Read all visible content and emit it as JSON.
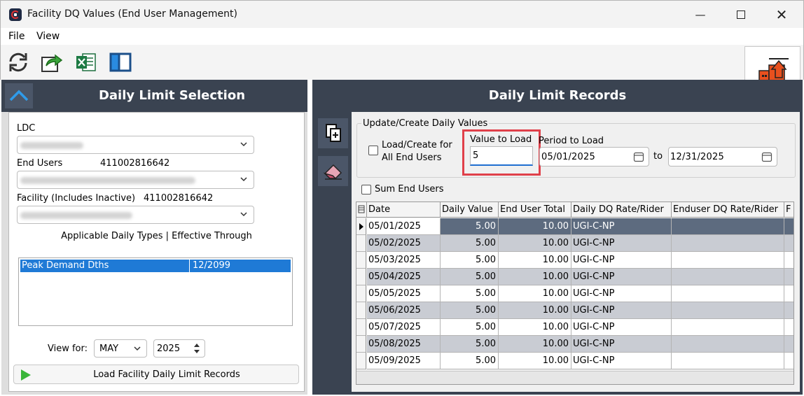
{
  "window": {
    "title": "Facility DQ Values (End User Management)",
    "minimize": "—",
    "close": "✕"
  },
  "menu": {
    "file": "File",
    "view": "View"
  },
  "toolbar": {
    "icons": [
      "refresh-icon",
      "export-icon",
      "excel-icon",
      "layout-icon"
    ]
  },
  "left": {
    "title": "Daily Limit Selection",
    "ldc_label": "LDC",
    "end_users_label": "End Users",
    "end_users_id": "411002816642",
    "facility_label": "Facility (Includes Inactive)",
    "facility_id": "411002816642",
    "types_header": "Applicable Daily Types | Effective Through",
    "types": [
      {
        "type": "Peak Demand Dths",
        "through": "12/2099"
      }
    ],
    "view_for_label": "View for:",
    "month": "MAY",
    "year": "2025",
    "load_button": "Load Facility Daily Limit Records"
  },
  "right": {
    "title": "Daily Limit Records",
    "group_title": "Update/Create Daily Values",
    "load_all_label_1": "Load/Create for",
    "load_all_label_2": "All End Users",
    "value_label": "Value to Load",
    "value": "5",
    "period_label": "Period to Load",
    "period_from": "05/01/2025",
    "to_label": "to",
    "period_to": "12/31/2025",
    "sum_label": "Sum End Users"
  },
  "grid": {
    "columns": [
      "Date",
      "Daily Value",
      "End User Total",
      "Daily DQ Rate/Rider",
      "Enduser DQ Rate/Rider",
      "F"
    ],
    "rows": [
      {
        "date": "05/01/2025",
        "daily": "5.00",
        "total": "10.00",
        "rate": "UGI-C-NP",
        "enduser": ""
      },
      {
        "date": "05/02/2025",
        "daily": "5.00",
        "total": "10.00",
        "rate": "UGI-C-NP",
        "enduser": ""
      },
      {
        "date": "05/03/2025",
        "daily": "5.00",
        "total": "10.00",
        "rate": "UGI-C-NP",
        "enduser": ""
      },
      {
        "date": "05/04/2025",
        "daily": "5.00",
        "total": "10.00",
        "rate": "UGI-C-NP",
        "enduser": ""
      },
      {
        "date": "05/05/2025",
        "daily": "5.00",
        "total": "10.00",
        "rate": "UGI-C-NP",
        "enduser": ""
      },
      {
        "date": "05/06/2025",
        "daily": "5.00",
        "total": "10.00",
        "rate": "UGI-C-NP",
        "enduser": ""
      },
      {
        "date": "05/07/2025",
        "daily": "5.00",
        "total": "10.00",
        "rate": "UGI-C-NP",
        "enduser": ""
      },
      {
        "date": "05/08/2025",
        "daily": "5.00",
        "total": "10.00",
        "rate": "UGI-C-NP",
        "enduser": ""
      },
      {
        "date": "05/09/2025",
        "daily": "5.00",
        "total": "10.00",
        "rate": "UGI-C-NP",
        "enduser": ""
      }
    ]
  },
  "colors": {
    "panel_header": "#3a4351",
    "accent": "#1f7ad6",
    "selected_cell": "#5d6b7f",
    "alt_row": "#c9ccd3",
    "highlight": "#e0404a"
  }
}
